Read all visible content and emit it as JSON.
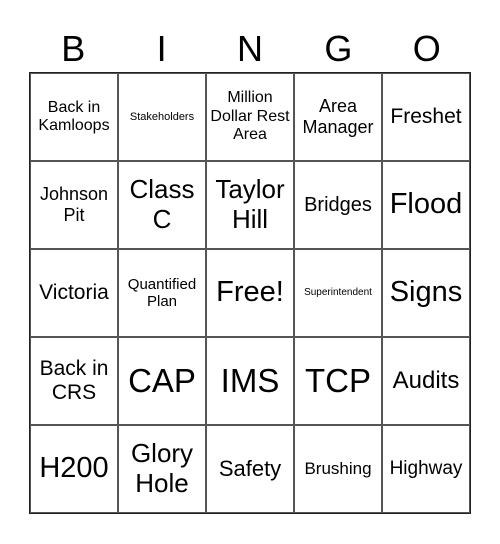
{
  "header": {
    "letters": [
      "B",
      "I",
      "N",
      "G",
      "O"
    ]
  },
  "board": {
    "rows": [
      [
        "Back in Kamloops",
        "Stakeholders",
        "Million Dollar Rest Area",
        "Area Manager",
        "Freshet"
      ],
      [
        "Johnson Pit",
        "Class C",
        "Taylor Hill",
        "Bridges",
        "Flood"
      ],
      [
        "Victoria",
        "Quantified Plan",
        "Free!",
        "Superintendent",
        "Signs"
      ],
      [
        "Back in CRS",
        "CAP",
        "IMS",
        "TCP",
        "Audits"
      ],
      [
        "H200",
        "Glory Hole",
        "Safety",
        "Brushing",
        "Highway"
      ]
    ]
  },
  "free_space": {
    "label": "Free!",
    "row": 3,
    "column": 3
  }
}
